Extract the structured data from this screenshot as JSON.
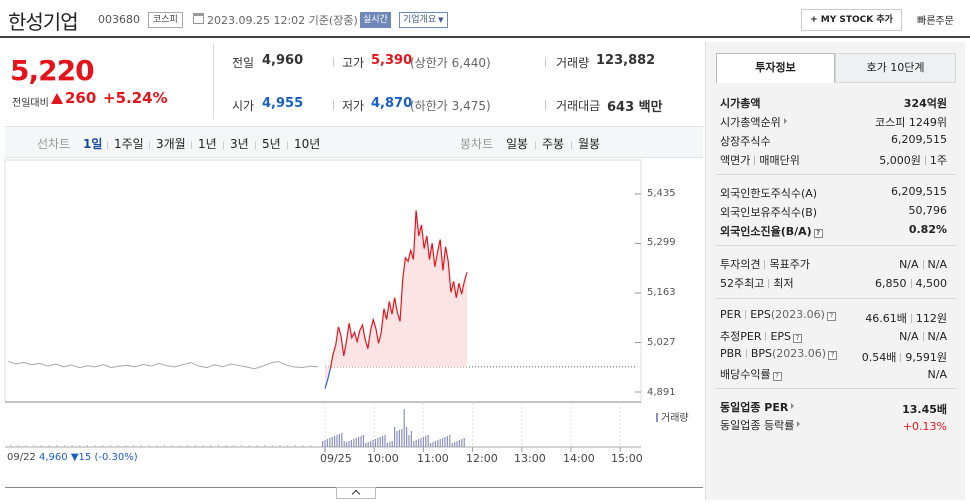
{
  "header": {
    "company_name": "한성기업",
    "stock_code": "003680",
    "market": "코스피",
    "datetime": "2023.09.25 12:02 기준(장중)",
    "realtime_badge": "실시간",
    "company_info_button": "기업개요",
    "my_stock_button": "+ MY STOCK 추가",
    "quick_order_button": "빠른주문"
  },
  "price": {
    "current": "5,220",
    "change_label": "전일대비",
    "change_value": "260",
    "change_rate": "+5.24%",
    "prev_close_label": "전일",
    "prev_close": "4,960",
    "high_label": "고가",
    "high": "5,390",
    "upper_limit": "(상한가 6,440)",
    "volume_label": "거래량",
    "volume": "123,882",
    "open_label": "시가",
    "open": "4,955",
    "low_label": "저가",
    "low": "4,870",
    "lower_limit": "(하한가 3,475)",
    "trade_value_label": "거래대금",
    "trade_value": "643 백만"
  },
  "chart_tabs": {
    "line_label": "선차트",
    "periods": [
      "1일",
      "1주일",
      "3개월",
      "1년",
      "3년",
      "5년",
      "10년"
    ],
    "selected": "1일",
    "candle_label": "봉차트",
    "candle_periods": [
      "일봉",
      "주봉",
      "월봉"
    ]
  },
  "chart_data": {
    "type": "line",
    "y_ticks": [
      "5,435",
      "5,299",
      "5,163",
      "5,027",
      "4,891"
    ],
    "ylim": [
      4891,
      5435
    ],
    "x_ticks": [
      "09/22",
      "09/25",
      "10:00",
      "11:00",
      "12:00",
      "13:00",
      "14:00",
      "15:00"
    ],
    "prev_close_ref": 4960,
    "volume_label": "거래량",
    "prev_day_summary": {
      "date": "09/22",
      "close": "4,960",
      "change": "▼15 (-0.30%)"
    },
    "prev_day_series": [
      4975,
      4968,
      4972,
      4966,
      4970,
      4962,
      4968,
      4960,
      4965,
      4958,
      4963,
      4960,
      4966,
      4958,
      4962,
      4964,
      4960,
      4967,
      4962,
      4970,
      4963,
      4960,
      4966,
      4972,
      4962,
      4958,
      4966,
      4960,
      4968,
      4964,
      4960,
      4955,
      4962,
      4970,
      4975,
      4965,
      4960,
      4958,
      4962,
      4960
    ],
    "today_series": [
      4900,
      4925,
      4955,
      4995,
      5020,
      5070,
      5045,
      4990,
      5030,
      5080,
      5040,
      5055,
      5030,
      5060,
      5075,
      5035,
      5010,
      5060,
      5090,
      5065,
      5025,
      5055,
      5120,
      5090,
      5140,
      5105,
      5150,
      5110,
      5085,
      5200,
      5260,
      5250,
      5280,
      5255,
      5390,
      5320,
      5350,
      5285,
      5320,
      5255,
      5300,
      5235,
      5275,
      5310,
      5225,
      5290,
      5250,
      5165,
      5195,
      5150,
      5190,
      5160,
      5195,
      5220
    ]
  },
  "right_panel": {
    "tabs": [
      "투자정보",
      "호가 10단계"
    ],
    "rows": {
      "market_cap_label": "시가총액",
      "market_cap": "324억원",
      "market_cap_rank_label": "시가총액순위",
      "market_cap_rank": "코스피 1249위",
      "shares_label": "상장주식수",
      "shares": "6,209,515",
      "par_label": "액면가",
      "unit_label": "매매단위",
      "par": "5,000원",
      "unit": "1주",
      "foreign_limit_label": "외국인한도주식수(A)",
      "foreign_limit": "6,209,515",
      "foreign_hold_label": "외국인보유주식수(B)",
      "foreign_hold": "50,796",
      "foreign_ratio_label": "외국인소진율(B/A)",
      "foreign_ratio": "0.82%",
      "opinion_label": "투자의견",
      "target_label": "목표주가",
      "opinion": "N/A",
      "target": "N/A",
      "w52_high_label": "52주최고",
      "w52_low_label": "최저",
      "w52_high": "6,850",
      "w52_low": "4,500",
      "per_label": "PER",
      "eps_label": "EPS",
      "eps_date": "(2023.06)",
      "per": "46.61배",
      "eps": "112원",
      "est_per_label": "추정PER",
      "est_eps_label": "EPS",
      "est_per": "N/A",
      "est_eps": "N/A",
      "pbr_label": "PBR",
      "bps_label": "BPS",
      "bps_date": "(2023.06)",
      "pbr": "0.54배",
      "bps": "9,591원",
      "div_label": "배당수익률",
      "div": "N/A",
      "sector_per_label": "동일업종 PER",
      "sector_per": "13.45배",
      "sector_chg_label": "동일업종 등락률",
      "sector_chg": "+0.13%"
    }
  }
}
